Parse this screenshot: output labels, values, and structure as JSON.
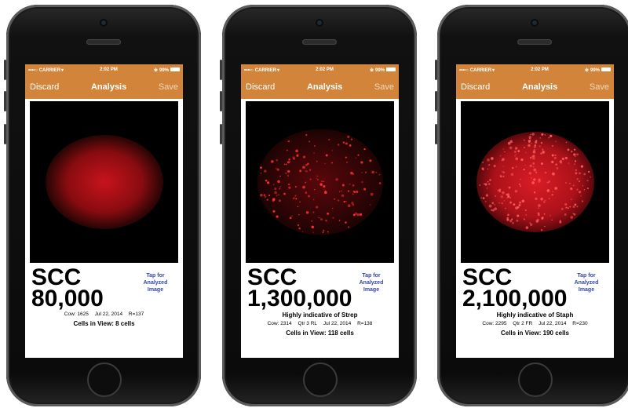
{
  "status": {
    "carrier": "••••○ CARRIER",
    "time": "2:02 PM",
    "battery": "99%"
  },
  "nav": {
    "discard": "Discard",
    "title": "Analysis",
    "save": "Save"
  },
  "tap_label": "Tap for Analyzed Image",
  "scc_label": "SCC",
  "phones": [
    {
      "scc_value": "80,000",
      "indicative": "",
      "cow": "Cow: 1625",
      "quarter": "",
      "date": "Jul 22, 2014",
      "r": "R=137",
      "cells": "Cells in View: 8 cells"
    },
    {
      "scc_value": "1,300,000",
      "indicative": "Highly indicative of Strep",
      "cow": "Cow: 2314",
      "quarter": "Qtr 3 RL",
      "date": "Jul 22, 2014",
      "r": "R=138",
      "cells": "Cells in View: 118 cells"
    },
    {
      "scc_value": "2,100,000",
      "indicative": "Highly indicative of Staph",
      "cow": "Cow: 2295",
      "quarter": "Qtr 2 FR",
      "date": "Jul 22, 2014",
      "r": "R=230",
      "cells": "Cells in View: 190 cells"
    }
  ],
  "icons": {
    "wifi": "wifi-icon",
    "bluetooth": "bluetooth-icon",
    "battery": "battery-icon"
  },
  "colors": {
    "navbar": "#d2853a",
    "link": "#3345a8",
    "sample_red": "#ff2020"
  }
}
